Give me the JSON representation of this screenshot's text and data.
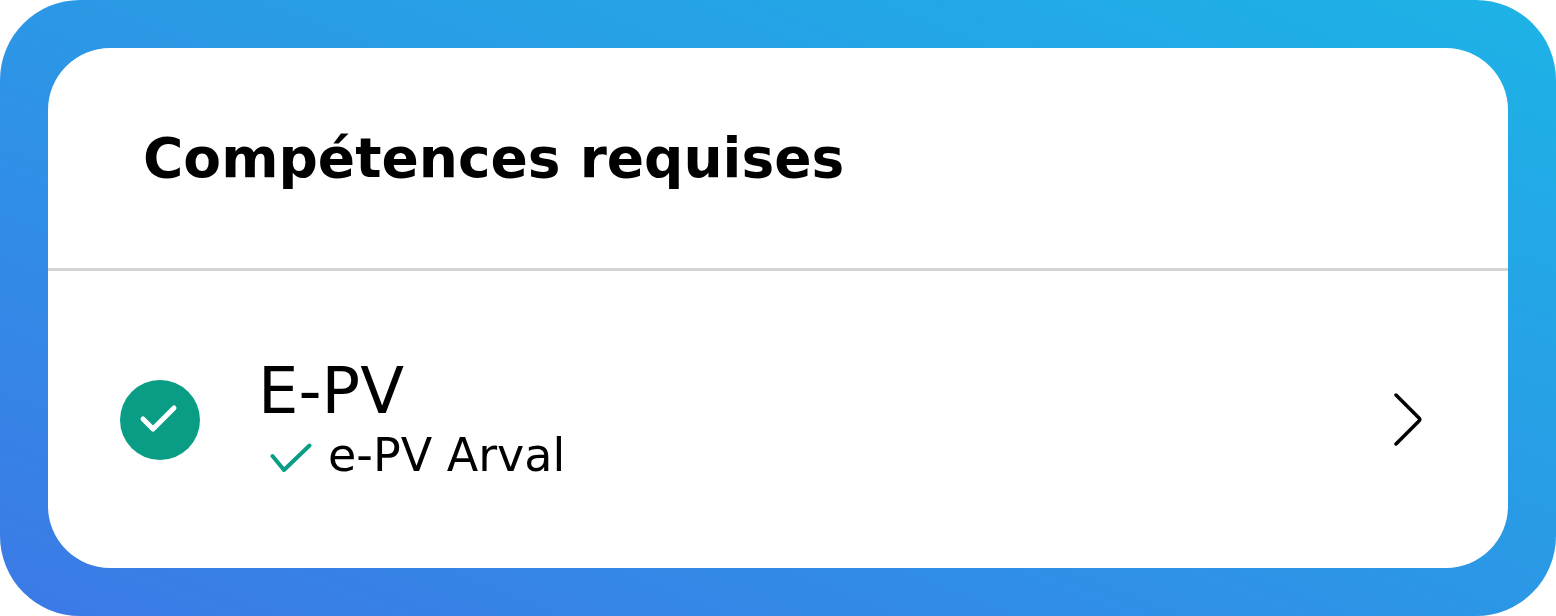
{
  "title": "Compétences requises",
  "skills": [
    {
      "name": "E-PV",
      "checked": true,
      "sub_items": [
        {
          "label": "e-PV Arval",
          "checked": true
        }
      ]
    }
  ]
}
